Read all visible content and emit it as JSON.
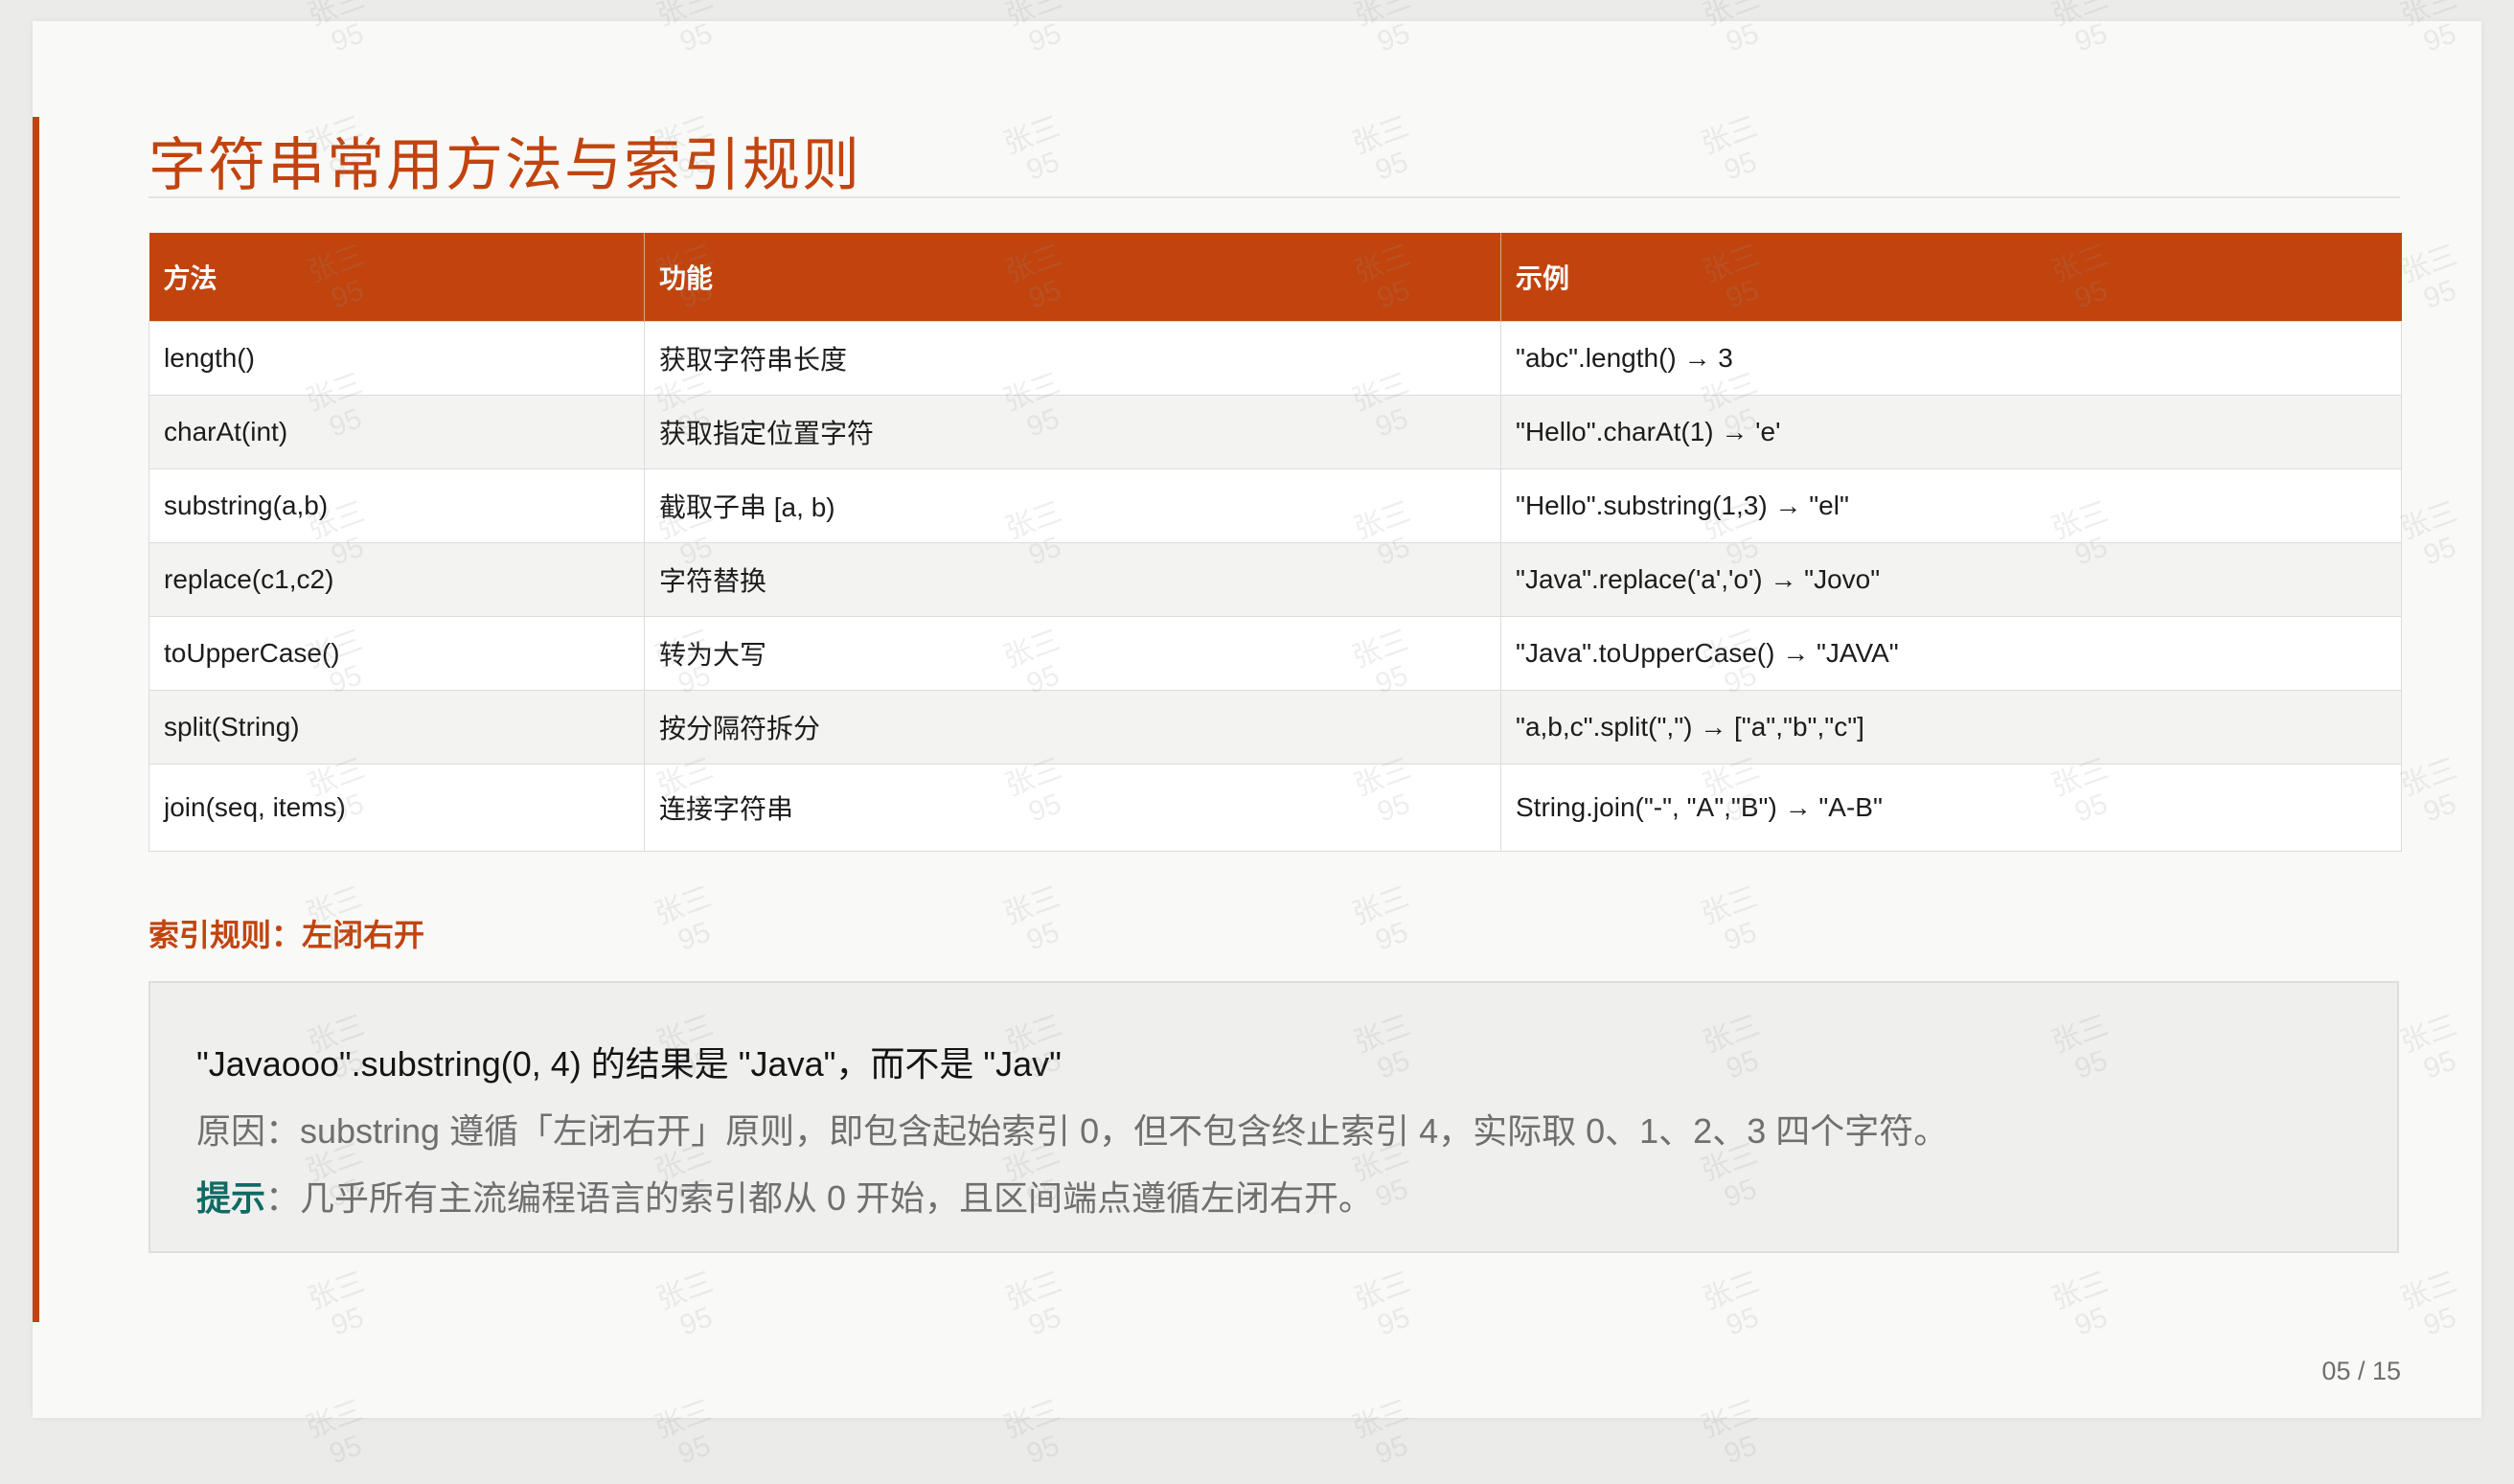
{
  "slide": {
    "title": "字符串常用方法与索引规则",
    "page_number": "05 / 15"
  },
  "table": {
    "headers": [
      "方法",
      "功能",
      "示例"
    ],
    "rows": [
      [
        "length()",
        "获取字符串长度",
        "\"abc\".length() → 3"
      ],
      [
        "charAt(int)",
        "获取指定位置字符",
        "\"Hello\".charAt(1) → 'e'"
      ],
      [
        "substring(a,b)",
        "截取子串 [a, b)",
        "\"Hello\".substring(1,3) → \"el\""
      ],
      [
        "replace(c1,c2)",
        "字符替换",
        "\"Java\".replace('a','o') → \"Jovo\""
      ],
      [
        "toUpperCase()",
        "转为大写",
        "\"Java\".toUpperCase() → \"JAVA\""
      ],
      [
        "split(String)",
        "按分隔符拆分",
        "\"a,b,c\".split(\",\") → [\"a\",\"b\",\"c\"]"
      ],
      [
        "join(seq, items)",
        "连接字符串",
        "String.join(\"-\", \"A\",\"B\") → \"A-B\""
      ]
    ]
  },
  "index_rule": {
    "heading": "索引规则：左闭右开",
    "main": "\"Javaooo\".substring(0, 4) 的结果是 \"Java\"，而不是 \"Jav\"",
    "reason": "原因：substring 遵循「左闭右开」原则，即包含起始索引 0，但不包含终止索引 4，实际取 0、1、2、3 四个字符。",
    "tip_label": "提示",
    "tip_text": "：几乎所有主流编程语言的索引都从 0 开始，且区间端点遵循左闭右开。"
  },
  "watermark": {
    "line1": "张三",
    "line2": "95"
  },
  "colors": {
    "accent": "#c1440e",
    "tip": "#0f6b64"
  }
}
